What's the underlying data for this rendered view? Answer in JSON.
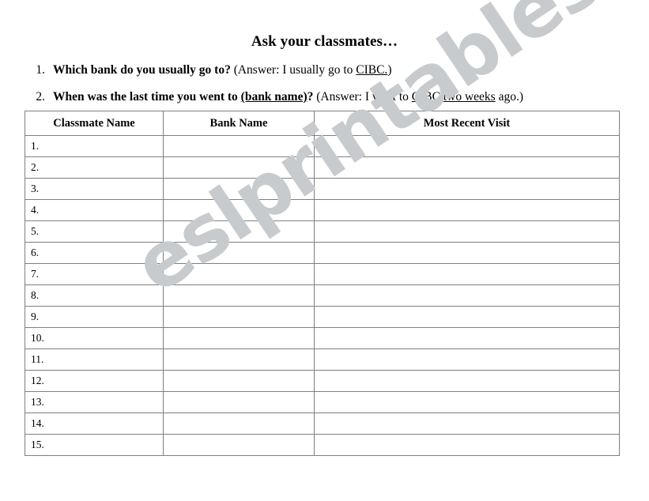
{
  "document": {
    "title": "Ask your classmates…"
  },
  "questions": [
    {
      "number": "1.",
      "prompt": "Which bank do you usually go to?",
      "answer_open": "(Answer: I usually go to ",
      "answer_underlined": "CIBC.",
      "answer_close": ")"
    },
    {
      "number": "2.",
      "prompt_part1": "When was the last time you went to ",
      "prompt_underlined": "(bank name)",
      "prompt_part2": "?",
      "answer_open": "(Answer: I went to ",
      "answer_underlined_1": "CIBC",
      "answer_mid": " ",
      "answer_underlined_2": "two weeks",
      "answer_close": " ago.)"
    }
  ],
  "table": {
    "headers": [
      "Classmate Name",
      "Bank Name",
      "Most Recent Visit"
    ],
    "rows": [
      {
        "num": "1.",
        "classmate_name": "",
        "bank_name": "",
        "most_recent_visit": ""
      },
      {
        "num": "2.",
        "classmate_name": "",
        "bank_name": "",
        "most_recent_visit": ""
      },
      {
        "num": "3.",
        "classmate_name": "",
        "bank_name": "",
        "most_recent_visit": ""
      },
      {
        "num": "4.",
        "classmate_name": "",
        "bank_name": "",
        "most_recent_visit": ""
      },
      {
        "num": "5.",
        "classmate_name": "",
        "bank_name": "",
        "most_recent_visit": ""
      },
      {
        "num": "6.",
        "classmate_name": "",
        "bank_name": "",
        "most_recent_visit": ""
      },
      {
        "num": "7.",
        "classmate_name": "",
        "bank_name": "",
        "most_recent_visit": ""
      },
      {
        "num": "8.",
        "classmate_name": "",
        "bank_name": "",
        "most_recent_visit": ""
      },
      {
        "num": "9.",
        "classmate_name": "",
        "bank_name": "",
        "most_recent_visit": ""
      },
      {
        "num": "10.",
        "classmate_name": "",
        "bank_name": "",
        "most_recent_visit": ""
      },
      {
        "num": "11.",
        "classmate_name": "",
        "bank_name": "",
        "most_recent_visit": ""
      },
      {
        "num": "12.",
        "classmate_name": "",
        "bank_name": "",
        "most_recent_visit": ""
      },
      {
        "num": "13.",
        "classmate_name": "",
        "bank_name": "",
        "most_recent_visit": ""
      },
      {
        "num": "14.",
        "classmate_name": "",
        "bank_name": "",
        "most_recent_visit": ""
      },
      {
        "num": "15.",
        "classmate_name": "",
        "bank_name": "",
        "most_recent_visit": ""
      }
    ]
  },
  "watermark": {
    "text": "eslprintables.com",
    "color": "#c8cbcd"
  },
  "colors": {
    "border": "#7f7f7f",
    "text": "#000000",
    "background": "#ffffff"
  }
}
